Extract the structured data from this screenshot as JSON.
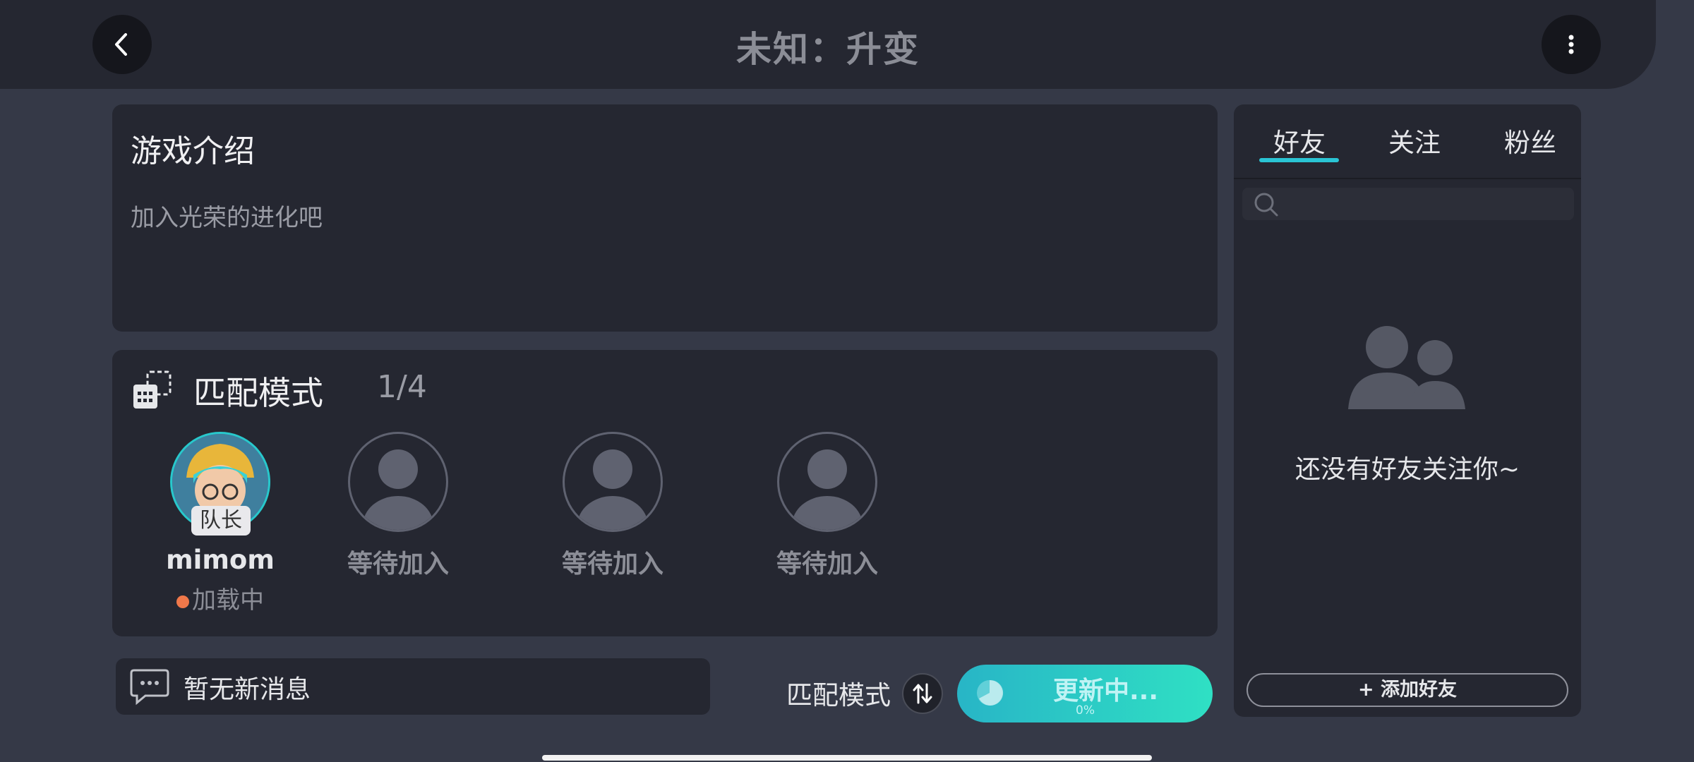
{
  "header": {
    "title": "未知：升变"
  },
  "intro": {
    "title": "游戏介绍",
    "description": "加入光荣的进化吧"
  },
  "match": {
    "title": "匹配模式",
    "count": "1/4",
    "captain": {
      "tag": "队长",
      "name": "mimom",
      "status": "加载中"
    },
    "waiting": [
      "等待加入",
      "等待加入",
      "等待加入"
    ]
  },
  "message": {
    "text": "暂无新消息"
  },
  "controls": {
    "mode_label": "匹配模式",
    "update_label": "更新中...",
    "update_percent": "0%"
  },
  "friends": {
    "tabs": [
      "好友",
      "关注",
      "粉丝"
    ],
    "active_tab": "好友",
    "search_placeholder": "",
    "empty_text": "还没有好友关注你~",
    "add_label": "+ 添加好友"
  },
  "colors": {
    "accent": "#2ac4d4",
    "status_loading": "#f0784a",
    "update_gradient_start": "#28b5c6",
    "update_gradient_end": "#2fe0c4"
  }
}
